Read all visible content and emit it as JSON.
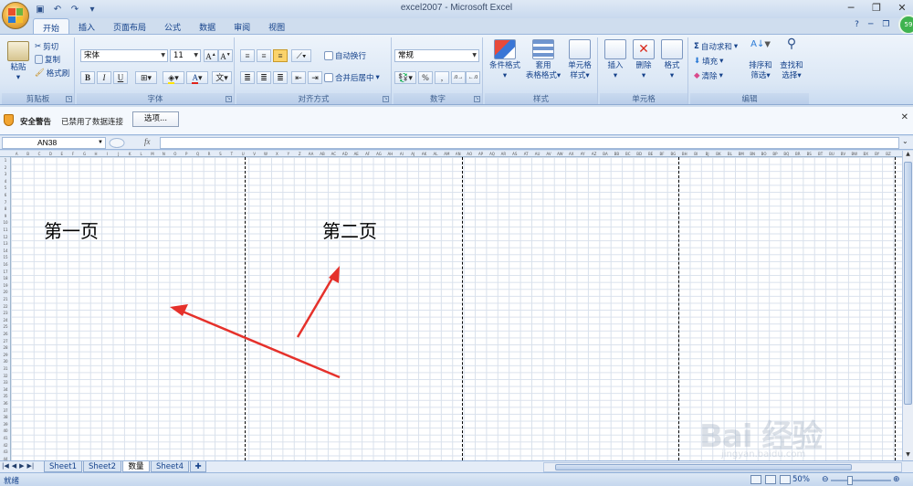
{
  "window": {
    "title": "excel2007 - Microsoft Excel",
    "controls": [
      "─",
      "❐",
      "✕"
    ]
  },
  "ribbon_tabs": [
    "开始",
    "插入",
    "页面布局",
    "公式",
    "数据",
    "审阅",
    "视图"
  ],
  "clipboard": {
    "label": "剪贴板",
    "paste": "粘贴",
    "cut": "剪切",
    "copy": "复制",
    "format_painter": "格式刷"
  },
  "font": {
    "label": "字体",
    "name": "宋体",
    "size": "11"
  },
  "alignment": {
    "label": "对齐方式",
    "wrap": "自动换行",
    "merge": "合并后居中"
  },
  "number": {
    "label": "数字",
    "format": "常规"
  },
  "styles": {
    "label": "样式",
    "conditional": "条件格式",
    "table_line1": "套用",
    "table_line2": "表格格式",
    "cell_line1": "单元格",
    "cell_line2": "样式"
  },
  "cells": {
    "label": "单元格",
    "insert": "插入",
    "delete": "删除",
    "format": "格式"
  },
  "editing": {
    "label": "编辑",
    "autosum": "自动求和",
    "fill": "填充",
    "clear": "清除",
    "sort_line1": "排序和",
    "sort_line2": "筛选",
    "find_line1": "查找和",
    "find_line2": "选择"
  },
  "security": {
    "title": "安全警告",
    "message": "已禁用了数据连接",
    "options": "选项..."
  },
  "formula_bar": {
    "name_box": "AN38",
    "fx": "fx",
    "value": ""
  },
  "sheet": {
    "page1_label": "第一页",
    "page2_label": "第二页"
  },
  "sheet_tabs": [
    "Sheet1",
    "Sheet2",
    "数量",
    "Sheet4"
  ],
  "active_sheet": "数量",
  "status": {
    "ready": "就绪",
    "zoom": "50%"
  },
  "avatar_text": "59",
  "watermark": {
    "text": "Bai 经验",
    "sub": "jingyan.baidu.com"
  },
  "colors": {
    "arrow": "#e5312b",
    "ribbon": "#dbe7f5",
    "accent": "#15428b"
  }
}
